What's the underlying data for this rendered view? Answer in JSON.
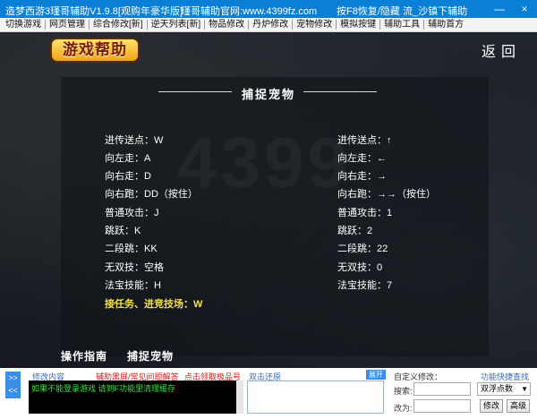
{
  "window": {
    "title": "造梦西游3瑾哥辅助V1.9.8[观购年豪华版]",
    "site": "瑾哥辅助官网:www.4399fz.com",
    "hint": "按F8恢复/隐藏",
    "status": "流_沙镇下辅助",
    "minimize": "—",
    "close": "×"
  },
  "menu": [
    "切换游戏",
    "网页管理",
    "综合修改[新]",
    "逆天列表[新]",
    "物品修改",
    "丹炉修改",
    "宠物修改",
    "模拟按键",
    "辅助工具",
    "辅助首方"
  ],
  "header": {
    "logo": "游戏帮助",
    "back": "返回"
  },
  "section": {
    "title": "捕捉宠物",
    "watermark": "4399"
  },
  "left_rows": [
    "进传送点：W",
    "向左走：A",
    "向右走：D",
    "向右跑：DD（按住）",
    "普通攻击：J",
    "跳跃：K",
    "二段跳：KK",
    "无双技：空格",
    "法宝技能：H"
  ],
  "left_highlight": "接任务、进竞技场：W",
  "right_rows": [
    "进传送点：↑",
    "向左走：←",
    "向右走：→",
    "向右跑：→→（按住）",
    "普通攻击：1",
    "跳跃：2",
    "二段跳：22",
    "无双技：0",
    "法宝技能：7"
  ],
  "tabs": [
    "操作指南",
    "捕捉宠物"
  ],
  "bottom": {
    "side_top": ">>",
    "side_bottom": "<<",
    "edit_label": "修改内容",
    "black_screen": "辅助黑屏/常见问题解答",
    "gift": "点击领取极品号",
    "double_click": "双击还原",
    "expand": "展开",
    "custom_edit": "自定义修改：",
    "quick_find": "功能快捷查找",
    "console_text": "如果不能登录游戏  请到F功能里清理缓存",
    "search_label": "搜索:",
    "change_label": "改为:",
    "select_value": "双浮点数",
    "modify_btn": "修改",
    "advanced_btn": "高级"
  }
}
